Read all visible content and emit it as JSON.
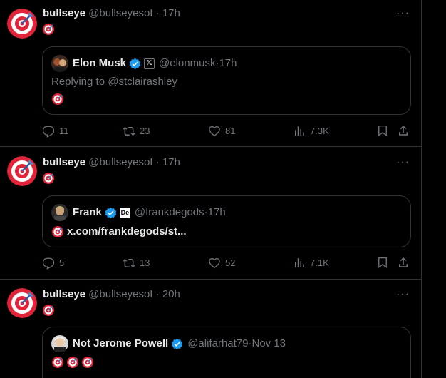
{
  "tweets": [
    {
      "name": "bullseye",
      "handle": "@bullseyesoI",
      "time": "17h",
      "text_emoji": "🎯",
      "quote": {
        "name": "Elon Musk",
        "affiliate_label": "𝕏",
        "handle": "@elonmusk",
        "time": "17h",
        "line1": "Replying to @stclairashley",
        "line2_emoji_count": 1
      },
      "replies": "11",
      "retweets": "23",
      "likes": "81",
      "views": "7.3K"
    },
    {
      "name": "bullseye",
      "handle": "@bullseyesoI",
      "time": "17h",
      "text_emoji": "🎯",
      "quote": {
        "name": "Frank",
        "affiliate_label": "De",
        "handle": "@frankdegods",
        "time": "17h",
        "link": "x.com/frankdegods/st..."
      },
      "replies": "5",
      "retweets": "13",
      "likes": "52",
      "views": "7.1K"
    },
    {
      "name": "bullseye",
      "handle": "@bullseyesoI",
      "time": "20h",
      "text_emoji": "🎯",
      "quote": {
        "name": "Not Jerome Powell",
        "handle": "@alifarhat79",
        "time": "Nov 13",
        "emoji_count": 3
      }
    }
  ],
  "separator": "·",
  "more_label": "···",
  "colors": {
    "background": "#000000",
    "text": "#e7e9ea",
    "muted": "#71767b",
    "border": "#2f3336",
    "verified": "#1d9bf0",
    "target_red": "#e0243a"
  },
  "icons": [
    "target-icon",
    "reply-icon",
    "retweet-icon",
    "like-icon",
    "views-icon",
    "bookmark-icon",
    "share-icon",
    "verified-badge-icon",
    "more-icon"
  ]
}
